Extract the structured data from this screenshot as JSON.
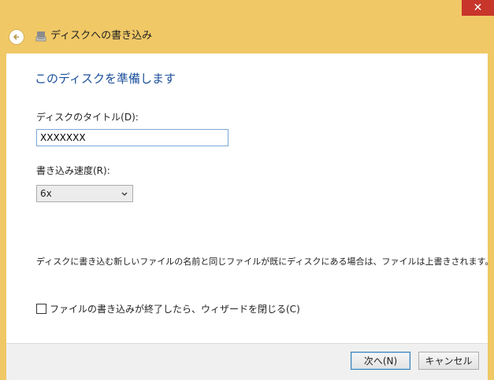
{
  "titlebar": {
    "close_label": "✕"
  },
  "header": {
    "title": "ディスクへの書き込み"
  },
  "main": {
    "heading": "このディスクを準備します",
    "disc_title_label": "ディスクのタイトル(D):",
    "disc_title_value": "XXXXXXX",
    "speed_label": "書き込み速度(R):",
    "speed_value": "6x",
    "info": "ディスクに書き込む新しいファイルの名前と同じファイルが既にディスクにある場合は、ファイルは上書きされます。",
    "close_wizard_label": "ファイルの書き込みが終了したら、ウィザードを閉じる(C)",
    "close_wizard_checked": false
  },
  "footer": {
    "next_label": "次へ(N)",
    "cancel_label": "キャンセル"
  },
  "colors": {
    "frame": "#f0c866",
    "accent_text": "#1b4f9b",
    "close": "#c7352b"
  }
}
